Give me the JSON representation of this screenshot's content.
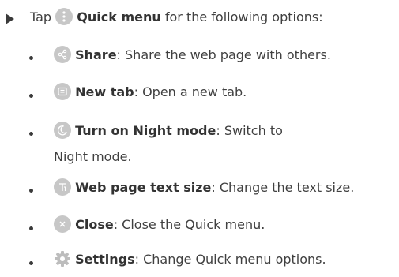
{
  "intro": {
    "before": "Tap",
    "term": "Quick menu",
    "after": " for the following options:",
    "icon": "more-vertical-icon"
  },
  "items": [
    {
      "term": "Share",
      "desc": ": Share the web page with others.",
      "icon": "share-icon"
    },
    {
      "term": "New tab",
      "desc": ": Open a new tab.",
      "icon": "new-tab-icon"
    },
    {
      "term": "Turn on Night mode",
      "desc": ": Switch to",
      "desc2": "Night mode.",
      "icon": "night-mode-icon"
    },
    {
      "term": "Web page text size",
      "desc": ": Change the text size.",
      "icon": "text-size-icon"
    },
    {
      "term": "Close",
      "desc": ": Close the Quick menu.",
      "icon": "close-icon"
    },
    {
      "term": "Settings",
      "desc": ": Change Quick menu options.",
      "icon": "gear-icon"
    }
  ],
  "colors": {
    "text": "#404040",
    "icon_bg": "#c7c7c7",
    "bullet": "#3a3a3a"
  }
}
